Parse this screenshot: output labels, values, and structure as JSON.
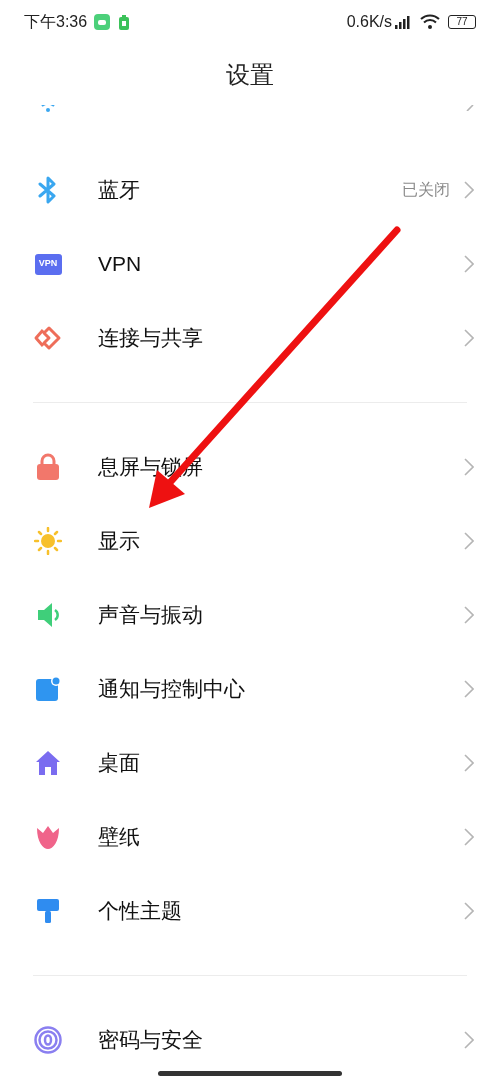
{
  "status_bar": {
    "time": "下午3:36",
    "network_speed": "0.6K/s",
    "battery": "77"
  },
  "title": "设置",
  "sections": [
    {
      "items": [
        {
          "kind": "bluetooth",
          "label": "蓝牙",
          "value": "已关闭"
        },
        {
          "kind": "vpn",
          "icon_text": "VPN",
          "label": "VPN"
        },
        {
          "kind": "share",
          "label": "连接与共享"
        }
      ]
    },
    {
      "items": [
        {
          "kind": "lock",
          "label": "息屏与锁屏"
        },
        {
          "kind": "sun",
          "label": "显示"
        },
        {
          "kind": "speaker",
          "label": "声音与振动"
        },
        {
          "kind": "notice",
          "label": "通知与控制中心"
        },
        {
          "kind": "home",
          "label": "桌面"
        },
        {
          "kind": "flower",
          "label": "壁纸"
        },
        {
          "kind": "brush",
          "label": "个性主题"
        }
      ]
    },
    {
      "items": [
        {
          "kind": "fingerprint",
          "label": "密码与安全"
        }
      ]
    }
  ]
}
